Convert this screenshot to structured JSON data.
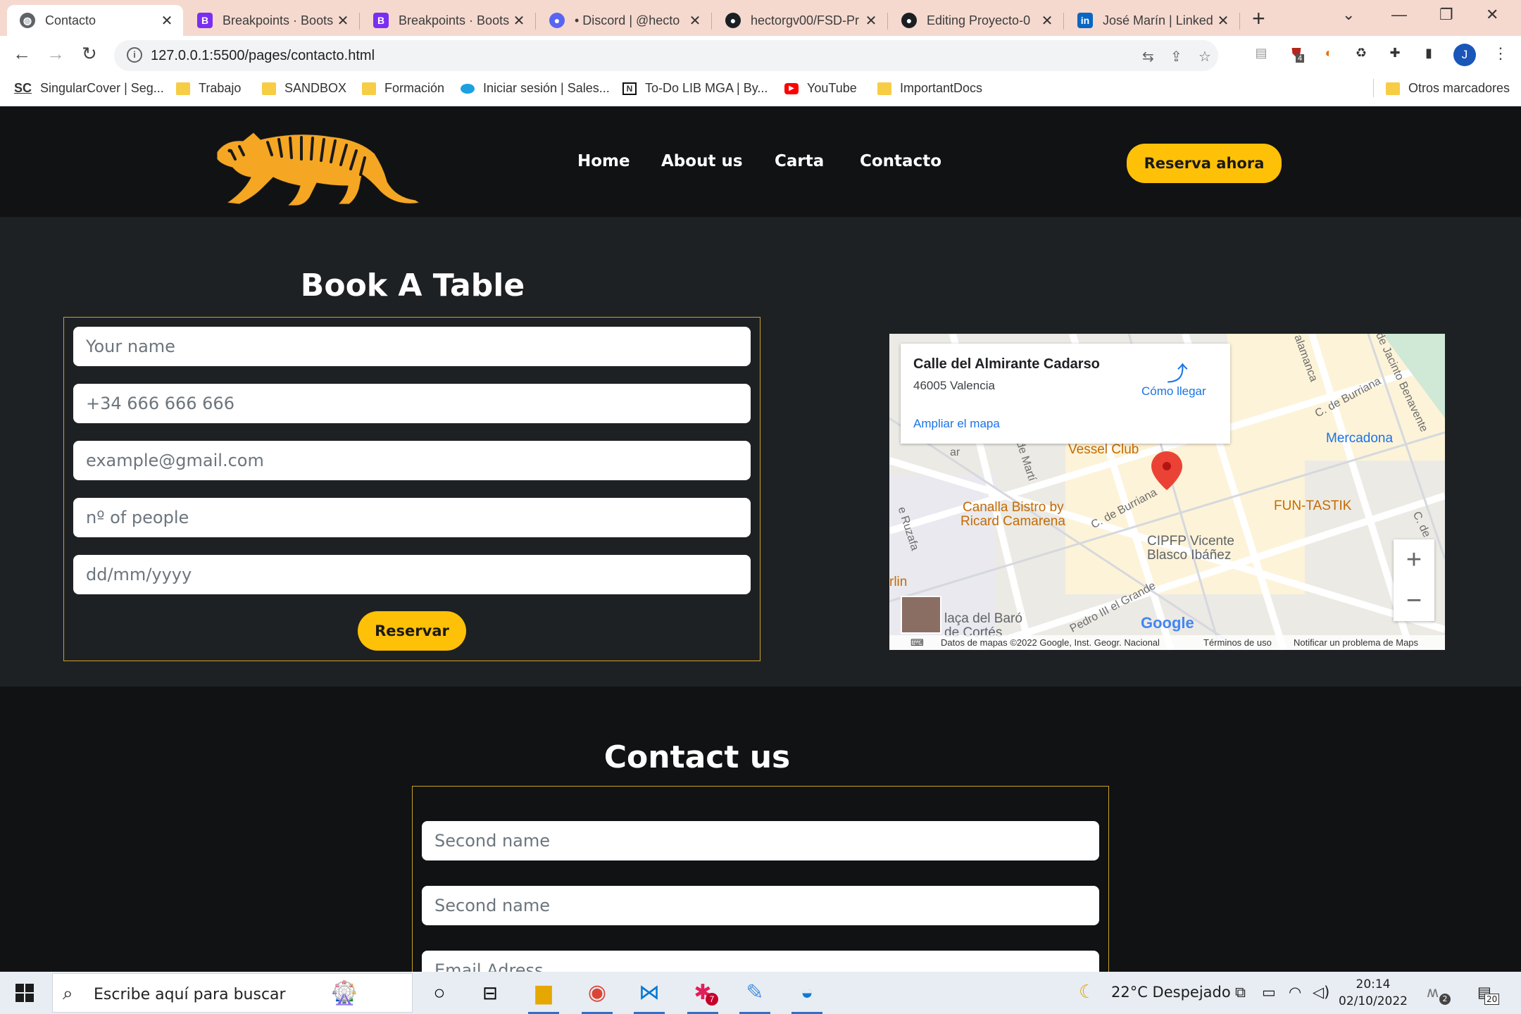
{
  "browser": {
    "tabs": [
      {
        "title": "Contacto",
        "favicon": "globe-icon",
        "active": true
      },
      {
        "title": "Breakpoints · Boots",
        "favicon": "bootstrap-icon",
        "active": false
      },
      {
        "title": "Breakpoints · Boots",
        "favicon": "bootstrap-icon",
        "active": false
      },
      {
        "title": "• Discord | @hecto",
        "favicon": "discord-icon",
        "active": false
      },
      {
        "title": "hectorgv00/FSD-Pr",
        "favicon": "github-icon",
        "active": false
      },
      {
        "title": "Editing Proyecto-0",
        "favicon": "github-icon",
        "active": false
      },
      {
        "title": "José Marín | Linked",
        "favicon": "linkedin-icon",
        "active": false
      }
    ],
    "url": "127.0.0.1:5500/pages/contacto.html",
    "extension_badge": "4",
    "profile_initial": "J",
    "bookmarks": [
      {
        "label": "SingularCover | Seg...",
        "icon": "sc-icon"
      },
      {
        "label": "Trabajo",
        "icon": "folder-icon"
      },
      {
        "label": "SANDBOX",
        "icon": "folder-icon"
      },
      {
        "label": "Formación",
        "icon": "folder-icon"
      },
      {
        "label": "Iniciar sesión | Sales...",
        "icon": "salesforce-icon"
      },
      {
        "label": "To-Do LIB MGA | By...",
        "icon": "notion-icon"
      },
      {
        "label": "YouTube",
        "icon": "youtube-icon"
      },
      {
        "label": "ImportantDocs",
        "icon": "folder-icon"
      }
    ],
    "other_bookmarks": "Otros marcadores",
    "sc_mark": "SC"
  },
  "site": {
    "nav": [
      "Home",
      "About us",
      "Carta",
      "Contacto"
    ],
    "cta": "Reserva ahora",
    "accent": "#ffc107",
    "book": {
      "title": "Book A Table",
      "fields": [
        "Your name",
        "+34 666 666 666",
        "example@gmail.com",
        "nº of people",
        "dd/mm/yyyy"
      ],
      "submit": "Reservar"
    },
    "map": {
      "place": "Calle del Almirante Cadarso",
      "address": "46005 Valencia",
      "directions": "Cómo llegar",
      "enlarge": "Ampliar el mapa",
      "pois": {
        "vessel": "Vessel Club",
        "mercadona": "Mercadona",
        "funtastik": "FUN-TASTIK",
        "canalla1": "Canalla Bistro by",
        "canalla2": "Ricard Camarena",
        "cipfp1": "CIPFP Vicente",
        "cipfp2": "Blasco Ibáñez",
        "placa1": "laça del Baró",
        "placa2": "de Cortés",
        "rlin": "rlin"
      },
      "streets": {
        "burriana1": "C. de Burriana",
        "burriana2": "C. de Burriana",
        "pedro": "Pedro III el Grande",
        "salamanca": "alamanca",
        "jacinto": "de Jacinto Benavente",
        "marti": "de Martí",
        "ruzafa": "e Ruzafa",
        "cde": "C. de",
        "ar": "ar"
      },
      "footer": {
        "data": "Datos de mapas ©2022 Google, Inst. Geogr. Nacional",
        "terms": "Términos de uso",
        "report": "Notificar un problema de Maps"
      },
      "google": "Google",
      "zoom_in": "+",
      "zoom_out": "−"
    },
    "contact": {
      "title": "Contact us",
      "fields": [
        "Second name",
        "Second name",
        "Email Adress"
      ]
    }
  },
  "taskbar": {
    "search_placeholder": "Escribe aquí para buscar",
    "weather": "22°C  Despejado",
    "time": "20:14",
    "date": "02/10/2022",
    "notifications": "20",
    "slack_badge": "7",
    "meet_badge": "2"
  }
}
